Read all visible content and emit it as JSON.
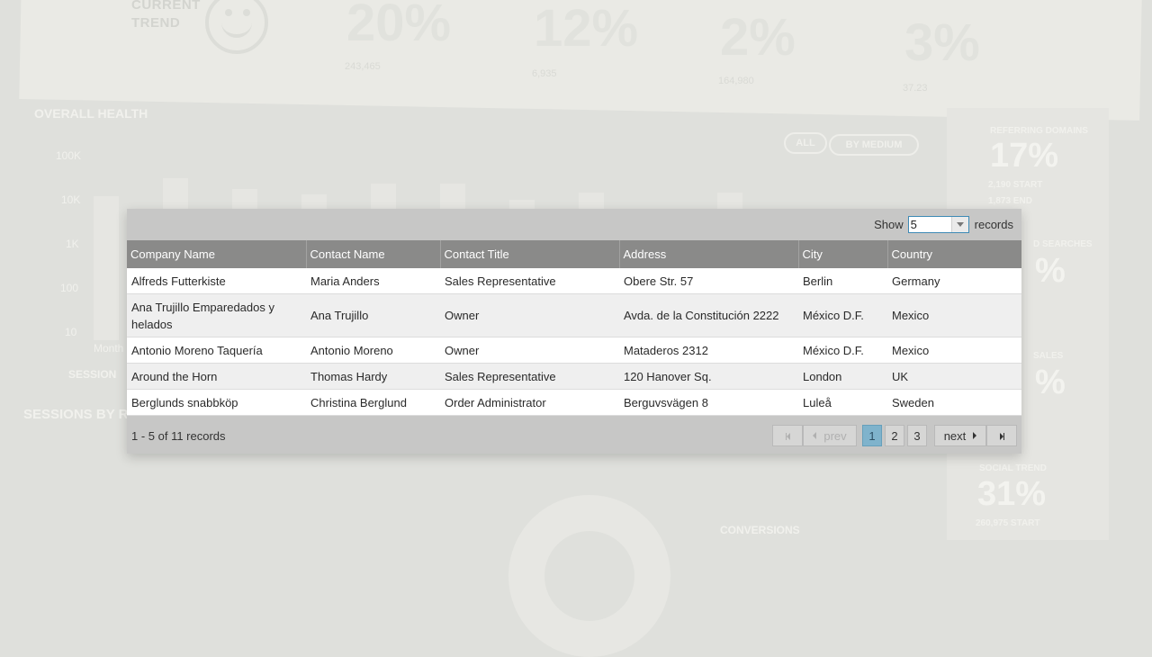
{
  "background": {
    "trend_label_line1": "CURRENT",
    "trend_label_line2": "TREND",
    "stats": [
      {
        "value": "20%",
        "sub": "243,465"
      },
      {
        "value": "12%",
        "sub": "6,935"
      },
      {
        "value": "2%",
        "sub": "164,980"
      },
      {
        "value": "3%",
        "sub": "37.23"
      }
    ],
    "overall_health": "OVERALL HEALTH",
    "y_ticks": [
      "100K",
      "10K",
      "1K",
      "100",
      "10"
    ],
    "month_label": "Month",
    "session_label": "SESSION",
    "toggle_all": "ALL",
    "toggle_medium": "BY MEDIUM",
    "sessions_title": "SESSIONS BY RE",
    "conversions": "CONVERSIONS",
    "right_panel": [
      {
        "title": "REFERRING DOMAINS",
        "big": "17%",
        "line1": "2,190 START",
        "line2": "1,873 END"
      },
      {
        "title": "D SEARCHES",
        "big": "%",
        "line1": "START",
        "line2": "END"
      },
      {
        "title": "SALES",
        "big": "%",
        "line1": "START",
        "line2": "END"
      },
      {
        "title": "SOCIAL TREND",
        "big": "31%",
        "line1": "260,975 START",
        "line2": ""
      }
    ]
  },
  "grid": {
    "toolbar": {
      "show_label": "Show",
      "page_size": "5",
      "records_label": "records"
    },
    "columns": [
      "Company Name",
      "Contact Name",
      "Contact Title",
      "Address",
      "City",
      "Country"
    ],
    "rows": [
      [
        "Alfreds Futterkiste",
        "Maria Anders",
        "Sales Representative",
        "Obere Str. 57",
        "Berlin",
        "Germany"
      ],
      [
        "Ana Trujillo Emparedados y helados",
        "Ana Trujillo",
        "Owner",
        "Avda. de la Constitución 2222",
        "México D.F.",
        "Mexico"
      ],
      [
        "Antonio Moreno Taquería",
        "Antonio Moreno",
        "Owner",
        "Mataderos 2312",
        "México D.F.",
        "Mexico"
      ],
      [
        "Around the Horn",
        "Thomas Hardy",
        "Sales Representative",
        "120 Hanover Sq.",
        "London",
        "UK"
      ],
      [
        "Berglunds snabbköp",
        "Christina Berglund",
        "Order Administrator",
        "Berguvsvägen 8",
        "Luleå",
        "Sweden"
      ]
    ],
    "footer": {
      "info": "1 - 5 of 11 records",
      "prev_label": "prev",
      "next_label": "next",
      "pages": [
        "1",
        "2",
        "3"
      ],
      "active_page": "1"
    }
  },
  "colors": {
    "header_bg": "#8a8a89",
    "active_page": "#7fb3cc",
    "input_border": "#3e8ab5"
  }
}
